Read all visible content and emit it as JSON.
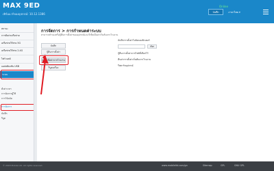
{
  "header": {
    "logo": "MAX 9ED",
    "subinfo": "เฟิร์มแวร์ของอุปกรณ์: 10.12.1386",
    "online": "Online",
    "save_label": "บันทึก",
    "language_label": "ภาษาไทย",
    "language_arrow": "▾"
  },
  "sidebar": {
    "items": [
      {
        "label": "สถานะ"
      },
      {
        "label": "การตั้งค่าเครือข่าย"
      },
      {
        "label": "เครือข่ายไร้สาย 5G"
      },
      {
        "label": "เครือข่ายไร้สาย 2.4G"
      },
      {
        "label": "ไฟร์วอลล์"
      },
      {
        "label": "แอปพลิเคชัน USB"
      }
    ],
    "active_item": "ระบบ",
    "subitems": [
      {
        "label": "ตั้งค่าเวลา"
      },
      {
        "label": "การจัดการผู้ใช้"
      },
      {
        "label": "การวินิจฉัย"
      }
    ],
    "active_subitem": "การจัดการ",
    "subitems_after": [
      {
        "label": "บันทึก"
      },
      {
        "label": "รีบูต"
      }
    ]
  },
  "main": {
    "title": "การจัดการ > การกำหนดค่าระบบ",
    "description": "สามารถสำรองหรือกู้คืนการตั้งค่าของอุปกรณ์และรีเซ็ตเป็นค่าเริ่มต้นจากโรงงาน",
    "buttons": {
      "backup": "บันทึก",
      "restore": "กู้คืนการตั้งค่า",
      "factory_reset": "การรีเซ็ตค่าจากโรงงาน",
      "reboot": "รีบูตเครื่อง"
    },
    "labels": {
      "backup_desc": "บันทึกการตั้งค่าไปยังคอมพิวเตอร์",
      "restore_desc": "กู้คืนการตั้งค่าจากไฟล์ที่เลือกไว้",
      "factory_desc": "คืนค่าการตั้งค่าเริ่มต้นจากโรงงาน",
      "reboot_desc": "รีสตาร์ทอุปกรณ์"
    },
    "choose_label": "เลือก"
  },
  "footer": {
    "copyright": "© 2018 Mobile Ltd. All rights reserved.",
    "links": [
      "www.mobileltd.com/gn",
      "Sitemap",
      "GPL",
      "GNU GPL"
    ]
  },
  "colors": {
    "header": "#1a87c9",
    "highlight": "#e01a22",
    "footer": "#3b3f44"
  }
}
